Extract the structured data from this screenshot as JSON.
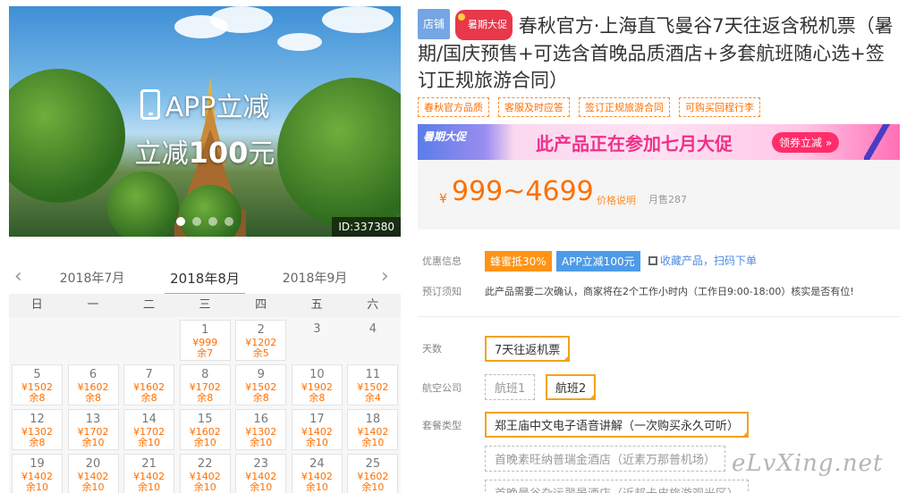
{
  "hero": {
    "line1": "APP立减",
    "line2_prefix": "立减",
    "line2_amount": "100",
    "line2_suffix": "元",
    "id_label": "ID:337380"
  },
  "calendar": {
    "months": [
      "2018年7月",
      "2018年8月",
      "2018年9月"
    ],
    "weekdays": [
      "日",
      "一",
      "二",
      "三",
      "四",
      "五",
      "六"
    ],
    "cells": [
      {
        "day": "1",
        "price": "¥999",
        "left": "余7",
        "col": 3,
        "row": 0
      },
      {
        "day": "2",
        "price": "¥1202",
        "left": "余5",
        "col": 4,
        "row": 0
      },
      {
        "day": "3",
        "price": "",
        "left": "",
        "col": 5,
        "row": 0
      },
      {
        "day": "4",
        "price": "",
        "left": "",
        "col": 6,
        "row": 0
      },
      {
        "day": "5",
        "price": "¥1502",
        "left": "余8",
        "col": 0,
        "row": 1
      },
      {
        "day": "6",
        "price": "¥1602",
        "left": "余8",
        "col": 1,
        "row": 1
      },
      {
        "day": "7",
        "price": "¥1602",
        "left": "余8",
        "col": 2,
        "row": 1
      },
      {
        "day": "8",
        "price": "¥1702",
        "left": "余8",
        "col": 3,
        "row": 1
      },
      {
        "day": "9",
        "price": "¥1502",
        "left": "余8",
        "col": 4,
        "row": 1
      },
      {
        "day": "10",
        "price": "¥1902",
        "left": "余8",
        "col": 5,
        "row": 1
      },
      {
        "day": "11",
        "price": "¥1502",
        "left": "余4",
        "col": 6,
        "row": 1
      },
      {
        "day": "12",
        "price": "¥1302",
        "left": "余8",
        "col": 0,
        "row": 2
      },
      {
        "day": "13",
        "price": "¥1702",
        "left": "余10",
        "col": 1,
        "row": 2
      },
      {
        "day": "14",
        "price": "¥1702",
        "left": "余10",
        "col": 2,
        "row": 2
      },
      {
        "day": "15",
        "price": "¥1602",
        "left": "余10",
        "col": 3,
        "row": 2
      },
      {
        "day": "16",
        "price": "¥1302",
        "left": "余10",
        "col": 4,
        "row": 2
      },
      {
        "day": "17",
        "price": "¥1402",
        "left": "余10",
        "col": 5,
        "row": 2
      },
      {
        "day": "18",
        "price": "¥1402",
        "left": "余10",
        "col": 6,
        "row": 2
      },
      {
        "day": "19",
        "price": "¥1402",
        "left": "余10",
        "col": 0,
        "row": 3
      },
      {
        "day": "20",
        "price": "¥1402",
        "left": "余10",
        "col": 1,
        "row": 3
      },
      {
        "day": "21",
        "price": "¥1402",
        "left": "余10",
        "col": 2,
        "row": 3
      },
      {
        "day": "22",
        "price": "¥1402",
        "left": "余10",
        "col": 3,
        "row": 3
      },
      {
        "day": "23",
        "price": "¥1402",
        "left": "余10",
        "col": 4,
        "row": 3
      },
      {
        "day": "24",
        "price": "¥1402",
        "left": "余10",
        "col": 5,
        "row": 3
      },
      {
        "day": "25",
        "price": "¥1602",
        "left": "余10",
        "col": 6,
        "row": 3
      }
    ]
  },
  "product": {
    "shop_tag": "店铺",
    "promo_tag": "暑期大促",
    "title": "春秋官方·上海直飞曼谷7天往返含税机票（暑期/国庆预售+可选含首晚品质酒店+多套航班随心选+签订正规旅游合同）",
    "feature_tags": [
      "春秋官方品质",
      "客服及时应答",
      "签订正规旅游合同",
      "可购买回程行李"
    ]
  },
  "banner": {
    "logo": "暑期大促",
    "text": "此产品正在参加七月大促",
    "button": "领券立减 »"
  },
  "price": {
    "currency": "¥",
    "range": "999~4699",
    "note": "价格说明",
    "sold": "月售287"
  },
  "offers": {
    "label": "优惠信息",
    "discount1": "蜂蜜抵30%",
    "discount2": "APP立减100元",
    "favorite": "收藏产品",
    "scan": "扫码下单"
  },
  "booking": {
    "label": "预订须知",
    "note": "此产品需要二次确认，商家将在2个工作小时内（工作日9:00-18:00）核实是否有位!"
  },
  "options": {
    "days_label": "天数",
    "days_value": "7天往返机票",
    "airline_label": "航空公司",
    "airline1": "航班1",
    "airline2": "航班2",
    "package_label": "套餐类型",
    "package1": "郑王庙中文电子语音讲解（一次购买永久可听）",
    "package2": "首晚素旺纳普瑞金酒店（近素万那普机场）",
    "package3": "首晚曼谷杂运翠景酒店（近邦卡皮旅游观光区）"
  },
  "watermark": "eLvXing.net",
  "colors": {
    "accent": "#ff6f00",
    "selected_border": "#f0a31f",
    "blue": "#4d9be8"
  }
}
